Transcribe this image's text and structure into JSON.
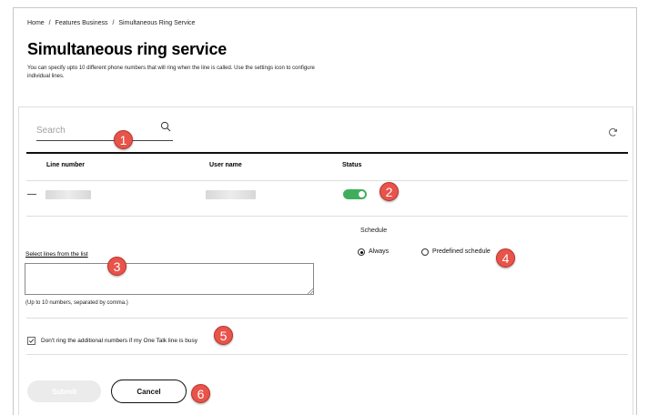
{
  "breadcrumb": {
    "items": [
      "Home",
      "Features Business",
      "Simultaneous Ring Service"
    ],
    "separator": "/"
  },
  "page": {
    "title": "Simultaneous ring service",
    "description": "You can specify upto 10 different phone numbers that will ring when the line is called. Use the settings icon to configure individual lines."
  },
  "search": {
    "placeholder": "Search"
  },
  "table": {
    "columns": [
      "Line number",
      "User name",
      "Status"
    ],
    "rows": [
      {
        "line_number": "",
        "user_name": "",
        "status_enabled": true
      }
    ]
  },
  "schedule": {
    "label": "Schedule",
    "options": [
      "Always",
      "Predefined schedule"
    ],
    "selected": "Always"
  },
  "lines": {
    "link": "Select lines from the list",
    "value": "",
    "hint": "(Up to 10 numbers, separated by comma.)"
  },
  "busy_option": {
    "label": "Don't ring the additional numbers if my One Talk line is busy",
    "checked": true
  },
  "buttons": {
    "submit": "Submit",
    "cancel": "Cancel"
  },
  "callouts": [
    "1",
    "2",
    "3",
    "4",
    "5",
    "6"
  ],
  "colors": {
    "toggle_on": "#3fae5c",
    "callout": "#e8534a"
  }
}
